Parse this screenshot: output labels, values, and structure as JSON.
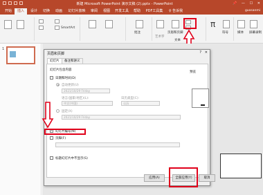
{
  "window": {
    "title": "新建 Microsoft PowerPoint 演示文稿 (2).pptx - PowerPoint",
    "controls": [
      "📌",
      "—",
      "☐",
      "✕"
    ]
  },
  "ribbon": {
    "tabs": [
      "开始",
      "插入",
      "设计",
      "切换",
      "动画",
      "幻灯片放映",
      "审阅",
      "视图",
      "开发工具",
      "帮助",
      "PDF工具集",
      "♀ 告诉我"
    ],
    "active_tab": "插入",
    "user": "guosanmi",
    "tools": {
      "smartart": "SmartArt",
      "comment": "批注",
      "header_footer": "页眉和页脚",
      "art_text": "艺术字",
      "symbol": "符号",
      "media": "媒体",
      "record": "屏幕录制",
      "text_group": "文本",
      "pi": "π"
    }
  },
  "thumbnails": {
    "number": "1"
  },
  "dialog": {
    "title": "页眉和页脚",
    "help": "?",
    "close": "✕",
    "tabs": [
      "幻灯片",
      "备注和讲义"
    ],
    "group_label": "幻灯片包含内容",
    "preview_label": "预览",
    "date_time": {
      "label": "日期和时间(D)",
      "checked": false
    },
    "auto_update": {
      "label": "自动更新(U)",
      "selected": true
    },
    "date_value": "2021/10/29 Friday",
    "language_label": "语言(国家/地区)(L):",
    "calendar_label": "日历类型(C):",
    "language_value": "中文(中国)",
    "calendar_value": "公历",
    "fixed": {
      "label": "固定(X)",
      "selected": false
    },
    "fixed_value": "2021/10/29 Friday",
    "slide_number": {
      "label": "幻灯片编号(N)",
      "checked": true
    },
    "footer": {
      "label": "页脚(F)",
      "checked": false
    },
    "footer_value": "",
    "title_slide": {
      "label": "标题幻灯片中不显示(S)",
      "checked": false
    },
    "buttons": {
      "apply": "应用(A)",
      "apply_all": "全部应用(Y)",
      "cancel": "取消"
    }
  },
  "colors": {
    "accent": "#b7472a",
    "highlight": "#e0001a"
  }
}
